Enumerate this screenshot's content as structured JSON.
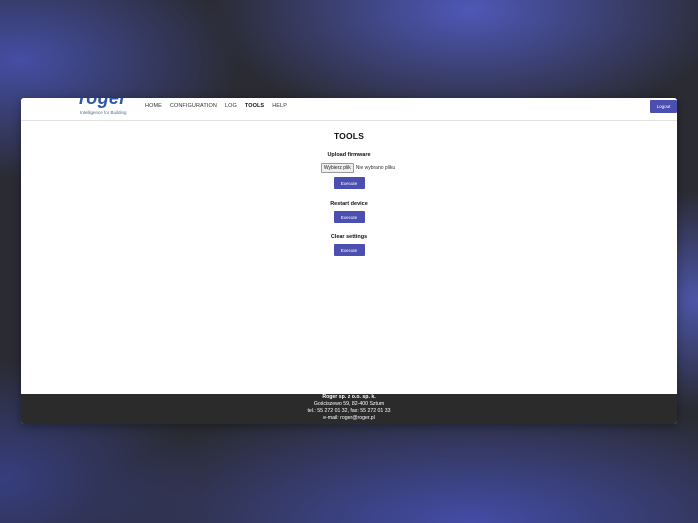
{
  "header": {
    "logo_text": "roger",
    "logo_tagline": "Intelligence for Building",
    "nav": [
      {
        "label": "HOME",
        "active": false
      },
      {
        "label": "CONFIGURATION",
        "active": false
      },
      {
        "label": "LOG",
        "active": false
      },
      {
        "label": "TOOLS",
        "active": true
      },
      {
        "label": "HELP",
        "active": false
      }
    ],
    "logout_label": "Logout"
  },
  "main": {
    "title": "TOOLS",
    "upload": {
      "title": "Upload firmware",
      "choose_file_label": "Wybierz plik",
      "no_file_text": "Nie wybrano pliku",
      "execute_label": "Execute"
    },
    "restart": {
      "title": "Restart device",
      "execute_label": "Execute"
    },
    "clear": {
      "title": "Clear settings",
      "execute_label": "Execute"
    }
  },
  "footer": {
    "company": "Roger sp. z o.o. sp. k.",
    "address": "Gościszewo 59, 82-400 Sztum",
    "phone": "tel.: 55 272 01 32, fax: 55 272 01 33",
    "email": "e-mail: roger@roger.pl"
  },
  "colors": {
    "accent": "#4a4fb0",
    "logo": "#2d57a8",
    "footer_bg": "#2b2b2b"
  }
}
